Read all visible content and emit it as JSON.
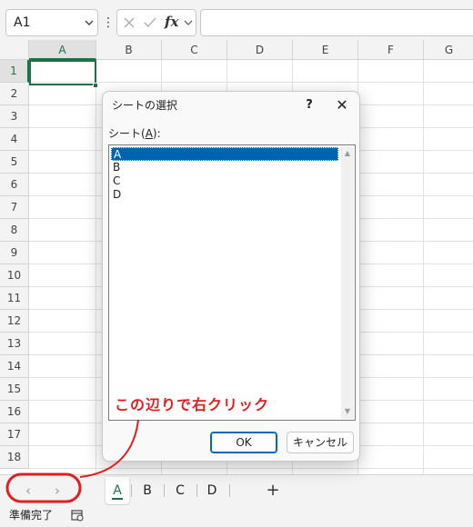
{
  "formula_bar": {
    "name_box": "A1",
    "fx_label": "fx",
    "cancel_icon": "close-icon",
    "enter_icon": "check-icon"
  },
  "grid": {
    "columns": [
      "A",
      "B",
      "C",
      "D",
      "E",
      "F",
      "G"
    ],
    "rows": [
      "1",
      "2",
      "3",
      "4",
      "5",
      "6",
      "7",
      "8",
      "9",
      "10",
      "11",
      "12",
      "13",
      "14",
      "15",
      "16",
      "17",
      "18"
    ],
    "selected_cell": "A1"
  },
  "dialog": {
    "title": "シートの選択",
    "help": "?",
    "close": "✕",
    "list_label_prefix": "シート(",
    "list_label_accel": "A",
    "list_label_suffix": "):",
    "sheets": [
      "A",
      "B",
      "C",
      "D"
    ],
    "selected_sheet": "A",
    "ok_label": "OK",
    "cancel_label": "キャンセル"
  },
  "tab_bar": {
    "prev_icon": "chevron-left-icon",
    "next_icon": "chevron-right-icon",
    "tabs": [
      "A",
      "B",
      "C",
      "D"
    ],
    "active_tab": "A",
    "add_label": "+"
  },
  "status_bar": {
    "text": "準備完了",
    "icon": "accessibility-icon"
  },
  "annotation": {
    "text": "この辺りで右クリック",
    "color": "#e02020"
  },
  "colors": {
    "accent": "#1e7145",
    "selection": "#0063b1",
    "annotation": "#e02020"
  }
}
